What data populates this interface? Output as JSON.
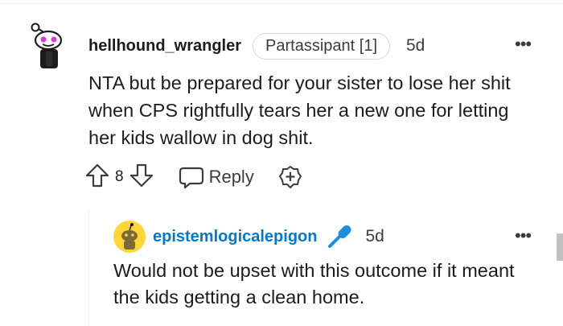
{
  "comment": {
    "author": "hellhound_wrangler",
    "flair": "Partassipant [1]",
    "time": "5d",
    "more_label": "•••",
    "body": "NTA but be prepared for your sister to lose her shit when CPS rightfully tears her a new one for letting her kids wallow in dog shit.",
    "score": "8",
    "reply_label": "Reply",
    "icons": {
      "avatar": "snoo-avatar-icon",
      "upvote": "upvote-arrow-icon",
      "downvote": "downvote-arrow-icon",
      "reply": "speech-bubble-icon",
      "award": "award-plus-icon",
      "more": "more-dots-icon"
    }
  },
  "reply": {
    "author": "epistemlogicalepigon",
    "time": "5d",
    "more_label": "•••",
    "body": "Would not be upset with this outcome if it meant the kids getting a clean home.",
    "icons": {
      "avatar": "snoo-avatar-yellow-icon",
      "badge": "microphone-icon",
      "more": "more-dots-icon"
    }
  },
  "colors": {
    "text": "#1c1c1c",
    "meta": "#3c3c3c",
    "link_blue": "#0079d3",
    "mic_blue": "#1a8ee1",
    "avatar_yellow": "#ffd635"
  }
}
